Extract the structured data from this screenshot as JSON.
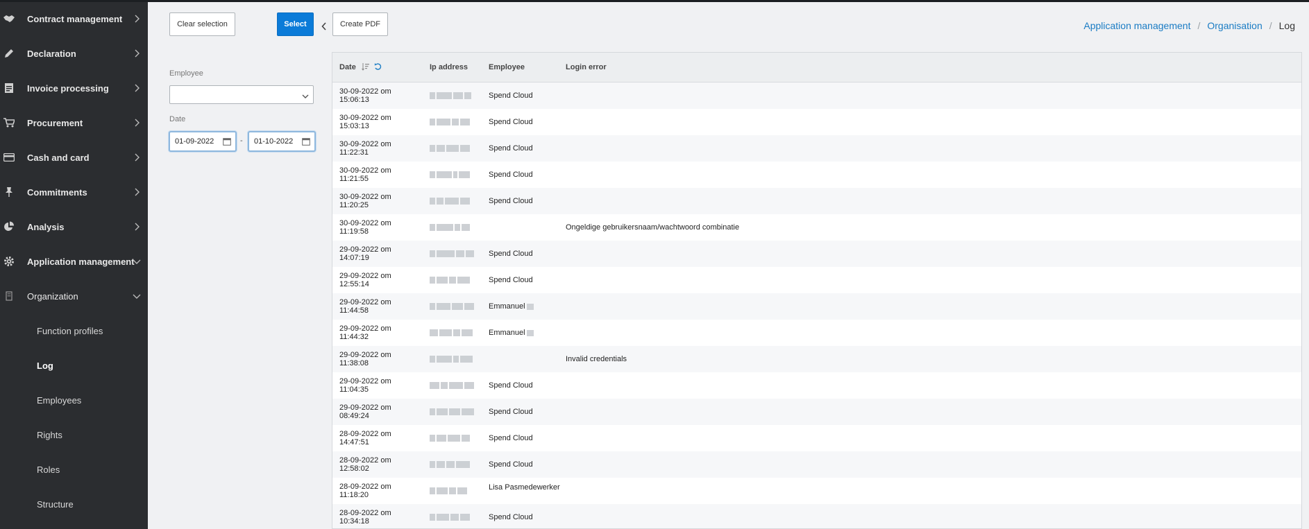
{
  "sidebar": {
    "items": [
      {
        "label": "Contract management",
        "icon": "handshake-icon",
        "expanded": false
      },
      {
        "label": "Declaration",
        "icon": "pencil-icon",
        "expanded": false
      },
      {
        "label": "Invoice processing",
        "icon": "invoice-icon",
        "expanded": false
      },
      {
        "label": "Procurement",
        "icon": "cart-icon",
        "expanded": false
      },
      {
        "label": "Cash and card",
        "icon": "card-icon",
        "expanded": false
      },
      {
        "label": "Commitments",
        "icon": "pin-icon",
        "expanded": false
      },
      {
        "label": "Analysis",
        "icon": "pie-chart-icon",
        "expanded": false
      },
      {
        "label": "Application management",
        "icon": "gear-icon",
        "expanded": true
      },
      {
        "label": "Organization",
        "icon": "building-icon",
        "expanded": true
      }
    ],
    "sub_items": [
      {
        "label": "Function profiles",
        "active": false
      },
      {
        "label": "Log",
        "active": true
      },
      {
        "label": "Employees",
        "active": false
      },
      {
        "label": "Rights",
        "active": false
      },
      {
        "label": "Roles",
        "active": false
      },
      {
        "label": "Structure",
        "active": false
      }
    ]
  },
  "toolbar": {
    "clear_label": "Clear selection",
    "select_label": "Select",
    "pdf_label": "Create PDF"
  },
  "breadcrumb": {
    "items": [
      "Application management",
      "Organisation"
    ],
    "current": "Log"
  },
  "filters": {
    "employee_label": "Employee",
    "employee_value": "",
    "date_label": "Date",
    "date_from": "01-09-2022",
    "date_to": "01-10-2022",
    "date_separator": "-"
  },
  "table": {
    "columns": [
      "Date",
      "Ip address",
      "Employee",
      "Login error"
    ],
    "rows": [
      {
        "date1": "30-09-2022 om",
        "date2": "15:06:13",
        "employee": "Spend Cloud",
        "error": ""
      },
      {
        "date1": "30-09-2022 om",
        "date2": "15:03:13",
        "employee": "Spend Cloud",
        "error": ""
      },
      {
        "date1": "30-09-2022 om",
        "date2": "11:22:31",
        "employee": "Spend Cloud",
        "error": ""
      },
      {
        "date1": "30-09-2022 om",
        "date2": "11:21:55",
        "employee": "Spend Cloud",
        "error": ""
      },
      {
        "date1": "30-09-2022 om",
        "date2": "11:20:25",
        "employee": "Spend Cloud",
        "error": ""
      },
      {
        "date1": "30-09-2022 om",
        "date2": "11:19:58",
        "employee": "",
        "error": "Ongeldige gebruikersnaam/wachtwoord combinatie"
      },
      {
        "date1": "29-09-2022 om",
        "date2": "14:07:19",
        "employee": "Spend Cloud",
        "error": ""
      },
      {
        "date1": "29-09-2022 om",
        "date2": "12:55:14",
        "employee": "Spend Cloud",
        "error": ""
      },
      {
        "date1": "29-09-2022 om",
        "date2": "11:44:58",
        "employee": "Emmanuel",
        "error": "",
        "redacted": true
      },
      {
        "date1": "29-09-2022 om",
        "date2": "11:44:32",
        "employee": "Emmanuel",
        "error": "",
        "redacted": true
      },
      {
        "date1": "29-09-2022 om",
        "date2": "11:38:08",
        "employee": "",
        "error": "Invalid credentials"
      },
      {
        "date1": "29-09-2022 om",
        "date2": "11:04:35",
        "employee": "Spend Cloud",
        "error": ""
      },
      {
        "date1": "29-09-2022 om",
        "date2": "08:49:24",
        "employee": "Spend Cloud",
        "error": ""
      },
      {
        "date1": "28-09-2022 om",
        "date2": "14:47:51",
        "employee": "Spend Cloud",
        "error": ""
      },
      {
        "date1": "28-09-2022 om",
        "date2": "12:58:02",
        "employee": "Spend Cloud",
        "error": ""
      },
      {
        "date1": "28-09-2022 om",
        "date2": "11:18:20",
        "employee": "Lisa Pasmedewerker",
        "error": "",
        "two_line": true
      },
      {
        "date1": "28-09-2022 om",
        "date2": "10:34:18",
        "employee": "Spend Cloud",
        "error": ""
      }
    ]
  },
  "colors": {
    "sidebar_bg": "#2b2d30",
    "accent": "#0b7bd8",
    "link": "#1a7cc4"
  }
}
